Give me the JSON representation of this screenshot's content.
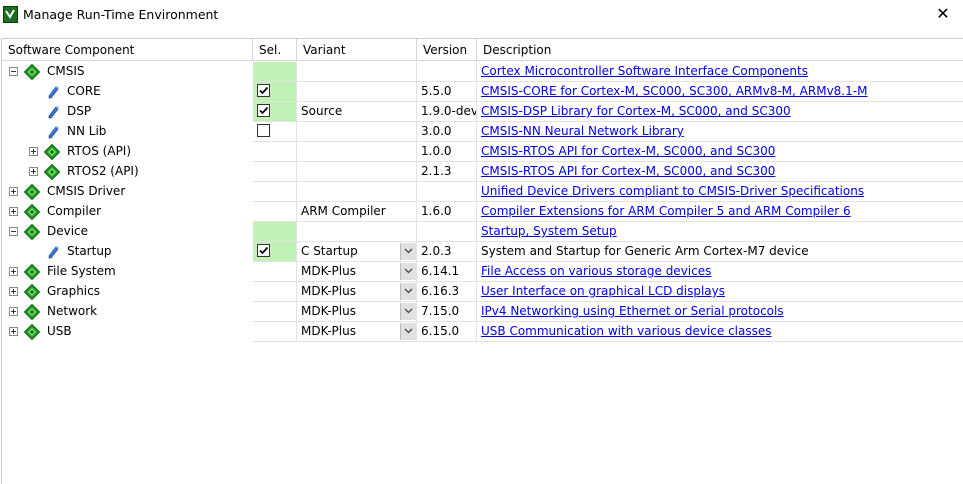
{
  "window": {
    "title": "Manage Run-Time Environment",
    "close_glyph": "✕"
  },
  "columns": {
    "component": "Software Component",
    "sel": "Sel.",
    "variant": "Variant",
    "version": "Version",
    "description": "Description"
  },
  "rows": [
    {
      "label": "CMSIS",
      "level": 0,
      "expander": "minus",
      "icon": "green-gem-icon",
      "sel_green": true,
      "checked": null,
      "variant": "",
      "dropdown": false,
      "version": "",
      "description": "Cortex Microcontroller Software Interface Components",
      "link": true
    },
    {
      "label": "CORE",
      "level": 2,
      "expander": "none",
      "icon": "blue-pen-icon",
      "sel_green": true,
      "checked": true,
      "variant": "",
      "dropdown": false,
      "version": "5.5.0",
      "description": "CMSIS-CORE for Cortex-M, SC000, SC300, ARMv8-M, ARMv8.1-M",
      "link": true
    },
    {
      "label": "DSP",
      "level": 2,
      "expander": "none",
      "icon": "blue-pen-icon",
      "sel_green": true,
      "checked": true,
      "variant": "Source",
      "dropdown": false,
      "version": "1.9.0-dev",
      "description": "CMSIS-DSP Library for Cortex-M, SC000, and SC300",
      "link": true
    },
    {
      "label": "NN Lib",
      "level": 2,
      "expander": "none",
      "icon": "blue-pen-icon",
      "sel_green": false,
      "checked": false,
      "variant": "",
      "dropdown": false,
      "version": "3.0.0",
      "description": "CMSIS-NN Neural Network Library",
      "link": true
    },
    {
      "label": "RTOS (API)",
      "level": 1,
      "expander": "plus",
      "icon": "green-gem-icon",
      "sel_green": false,
      "checked": null,
      "variant": "",
      "dropdown": false,
      "version": "1.0.0",
      "description": "CMSIS-RTOS API for Cortex-M, SC000, and SC300",
      "link": true
    },
    {
      "label": "RTOS2 (API)",
      "level": 1,
      "expander": "plus",
      "icon": "green-gem-icon",
      "sel_green": false,
      "checked": null,
      "variant": "",
      "dropdown": false,
      "version": "2.1.3",
      "description": "CMSIS-RTOS API for Cortex-M, SC000, and SC300",
      "link": true
    },
    {
      "label": "CMSIS Driver",
      "level": 0,
      "expander": "plus",
      "icon": "green-gem-icon",
      "sel_green": false,
      "checked": null,
      "variant": "",
      "dropdown": false,
      "version": "",
      "description": "Unified Device Drivers compliant to CMSIS-Driver Specifications",
      "link": true
    },
    {
      "label": "Compiler",
      "level": 0,
      "expander": "plus",
      "icon": "green-gem-icon",
      "sel_green": false,
      "checked": null,
      "variant": "ARM Compiler",
      "dropdown": false,
      "version": "1.6.0",
      "description": "Compiler Extensions for ARM Compiler 5 and ARM Compiler 6",
      "link": true
    },
    {
      "label": "Device",
      "level": 0,
      "expander": "minus",
      "icon": "green-gem-icon",
      "sel_green": true,
      "checked": null,
      "variant": "",
      "dropdown": false,
      "version": "",
      "description": "Startup, System Setup",
      "link": true
    },
    {
      "label": "Startup",
      "level": 2,
      "expander": "none",
      "icon": "blue-pen-icon",
      "sel_green": true,
      "checked": true,
      "variant": "C Startup",
      "dropdown": true,
      "version": "2.0.3",
      "description": "System and Startup for Generic Arm Cortex-M7 device",
      "link": false
    },
    {
      "label": "File System",
      "level": 0,
      "expander": "plus",
      "icon": "green-gem-icon",
      "sel_green": false,
      "checked": null,
      "variant": "MDK-Plus",
      "dropdown": true,
      "version": "6.14.1",
      "description": "File Access on various storage devices",
      "link": true
    },
    {
      "label": "Graphics",
      "level": 0,
      "expander": "plus",
      "icon": "green-gem-icon",
      "sel_green": false,
      "checked": null,
      "variant": "MDK-Plus",
      "dropdown": true,
      "version": "6.16.3",
      "description": "User Interface on graphical LCD displays",
      "link": true
    },
    {
      "label": "Network",
      "level": 0,
      "expander": "plus",
      "icon": "green-gem-icon",
      "sel_green": false,
      "checked": null,
      "variant": "MDK-Plus",
      "dropdown": true,
      "version": "7.15.0",
      "description": "IPv4 Networking using Ethernet or Serial protocols",
      "link": true
    },
    {
      "label": "USB",
      "level": 0,
      "expander": "plus",
      "icon": "green-gem-icon",
      "sel_green": false,
      "checked": null,
      "variant": "MDK-Plus",
      "dropdown": true,
      "version": "6.15.0",
      "description": "USB Communication with various device classes",
      "link": true
    }
  ]
}
